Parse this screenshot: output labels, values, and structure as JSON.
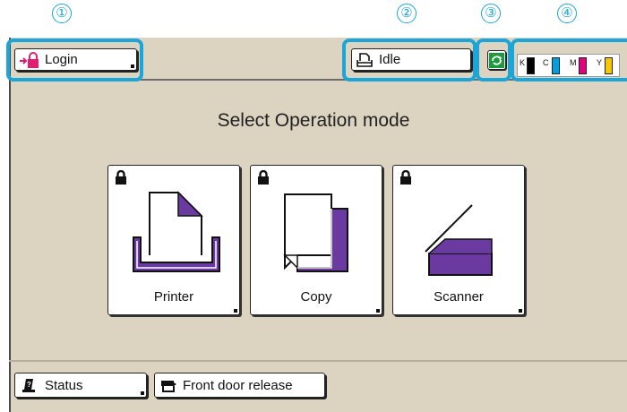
{
  "callouts": [
    "①",
    "②",
    "③",
    "④"
  ],
  "topbar": {
    "login_label": "Login",
    "status_label": "Idle",
    "ink": [
      {
        "letter": "K",
        "color": "#000000"
      },
      {
        "letter": "C",
        "color": "#00a0e0"
      },
      {
        "letter": "M",
        "color": "#e4007f"
      },
      {
        "letter": "Y",
        "color": "#f5c800"
      }
    ]
  },
  "main": {
    "title": "Select Operation mode",
    "modes": [
      {
        "label": "Printer",
        "icon": "printer-icon"
      },
      {
        "label": "Copy",
        "icon": "copy-icon"
      },
      {
        "label": "Scanner",
        "icon": "scanner-icon"
      }
    ]
  },
  "bottom": {
    "status_label": "Status",
    "front_door_label": "Front door release"
  },
  "colors": {
    "accent": "#1aa6d9",
    "background": "#ddd3c1",
    "icon_purple": "#6a3aa0",
    "lock_pink": "#e0206e",
    "sync_green": "#1a9a3a"
  }
}
